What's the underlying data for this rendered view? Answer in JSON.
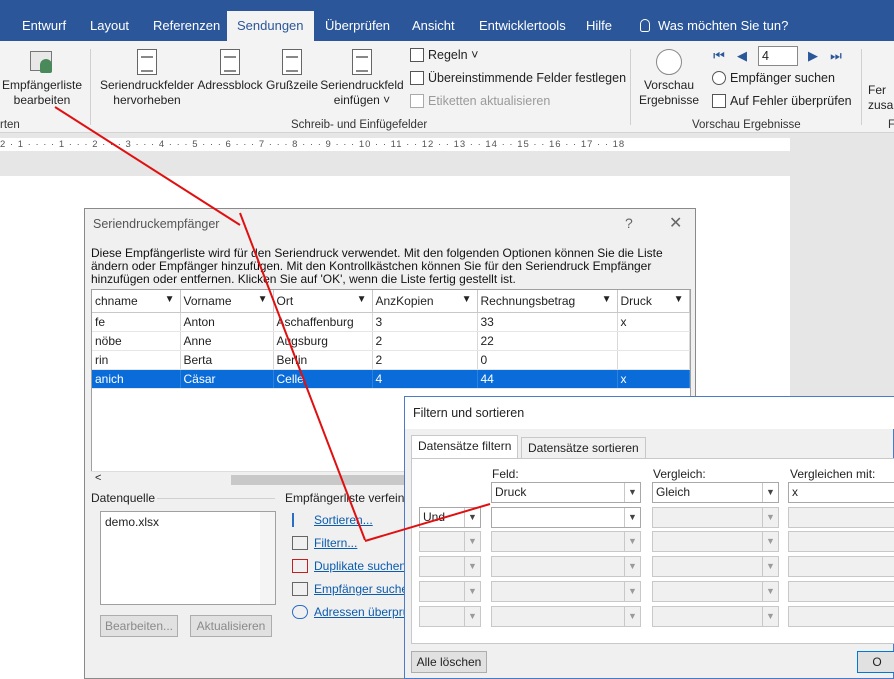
{
  "ribbon": {
    "tabs": [
      "Entwurf",
      "Layout",
      "Referenzen",
      "Sendungen",
      "Überprüfen",
      "Ansicht",
      "Entwicklertools",
      "Hilfe",
      "Was möchten Sie tun?"
    ],
    "active_tab": "Sendungen",
    "buttons": {
      "recipients_line1": "Empfängerliste",
      "recipients_line2": "bearbeiten",
      "highlight_line1": "Seriendruckfelder",
      "highlight_line2": "hervorheben",
      "address_block": "Adressblock",
      "greeting_line": "Grußzeile",
      "insert_field_line1": "Seriendruckfeld",
      "insert_field_line2": "einfügen ˅",
      "rules": "Regeln ˅",
      "match_fields": "Übereinstimmende Felder festlegen",
      "update_labels": "Etiketten aktualisieren",
      "preview_line1": "Vorschau",
      "preview_line2": "Ergebnisse",
      "find_recipient": "Empfänger suchen",
      "check_errors": "Auf Fehler überprüfen",
      "finish_line1": "Fer",
      "finish_line2": "zusa"
    },
    "record_number": "4",
    "groups": {
      "left_cut": "rten",
      "write_insert": "Schreib- und Einfügefelder",
      "preview": "Vorschau Ergebnisse",
      "right_cut": "F"
    }
  },
  "ruler_text": "2 · 1 · · · · 1 · · · 2 · · · 3 · · · 4 · · · 5 · · · 6 · · · 7 · · · 8 · · · 9 · · · 10 · · 11 · · 12 · · 13 · · 14 · · 15 · · 16 · · 17 · · 18",
  "recipients_dialog": {
    "title": "Seriendruckempfänger",
    "help": "?",
    "close": "✕",
    "description": "Diese Empfängerliste wird für den Seriendruck verwendet. Mit den folgenden Optionen können Sie die Liste ändern oder Empfänger hinzufügen. Mit den Kontrollkästchen können Sie für den Seriendruck Empfänger hinzufügen oder entfernen. Klicken Sie auf 'OK', wenn die Liste fertig gestellt ist.",
    "columns": [
      "chname",
      "Vorname",
      "Ort",
      "AnzKopien",
      "Rechnungsbetrag",
      "Druck"
    ],
    "rows": [
      [
        "fe",
        "Anton",
        "Aschaffenburg",
        "3",
        "33",
        "x"
      ],
      [
        "nöbe",
        "Anne",
        "Augsburg",
        "2",
        "22",
        ""
      ],
      [
        "rin",
        "Berta",
        "Berlin",
        "2",
        "0",
        ""
      ],
      [
        "anich",
        "Cäsar",
        "Celle",
        "4",
        "44",
        "x"
      ]
    ],
    "scroll_left": "<",
    "datasource_label": "Datenquelle",
    "datasource_item": "demo.xlsx",
    "refine_label": "Empfängerliste verfeine",
    "edit_button": "Bearbeiten...",
    "refresh_button": "Aktualisieren",
    "links": [
      "Sortieren...",
      "Filtern...",
      "Duplikate suchen",
      "Empfänger suche",
      "Adressen überprü"
    ]
  },
  "filter_dialog": {
    "title": "Filtern und sortieren",
    "tab_filter": "Datensätze filtern",
    "tab_sort": "Datensätze sortieren",
    "label_field": "Feld:",
    "label_compare": "Vergleich:",
    "label_compare_with": "Vergleichen mit:",
    "row1": {
      "field": "Druck",
      "compare": "Gleich",
      "value": "x"
    },
    "row2_op": "Und",
    "clear_button": "Alle löschen",
    "ok_button": "O"
  },
  "colors": {
    "ribbon_blue": "#2b579a",
    "selection_blue": "#0a6cd8",
    "annotation_red": "#e01010"
  }
}
